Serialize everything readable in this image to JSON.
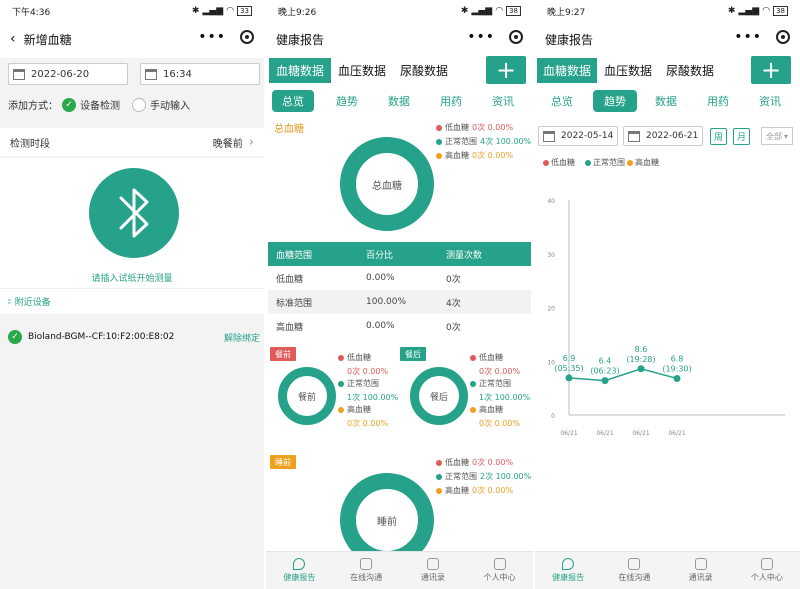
{
  "p1": {
    "status_time": "下午4:36",
    "battery": "33",
    "nav_title": "新增血糖",
    "date": "2022-06-20",
    "time": "16:34",
    "add_method_label": "添加方式：",
    "method_device": "设备检测",
    "method_manual": "手动输入",
    "period_label": "检测时段",
    "period_value": "晚餐前",
    "bt_hint": "请插入试纸开始测量",
    "nearby_label": "附近设备",
    "device_name": "Bioland-BGM--CF:10:F2:00:E8:02",
    "unbind": "解除绑定"
  },
  "p2": {
    "status_time": "晚上9:26",
    "battery": "38",
    "nav_title": "健康报告",
    "type_tabs": [
      "血糖数据",
      "血压数据",
      "尿酸数据"
    ],
    "sub_tabs": [
      "总览",
      "趋势",
      "数据",
      "用药",
      "资讯"
    ],
    "section_total": "总血糖",
    "donut_total": "总血糖",
    "legend_total": [
      {
        "name": "低血糖",
        "value": "0次 0.00%",
        "color": "#e05a5a"
      },
      {
        "name": "正常范围",
        "value": "4次 100.00%",
        "color": "#26a28a"
      },
      {
        "name": "高血糖",
        "value": "0次 0.00%",
        "color": "#f0a020"
      }
    ],
    "table": {
      "headers": [
        "血糖范围",
        "百分比",
        "测量次数"
      ],
      "rows": [
        [
          "低血糖",
          "0.00%",
          "0次"
        ],
        [
          "标准范围",
          "100.00%",
          "4次"
        ],
        [
          "高血糖",
          "0.00%",
          "0次"
        ]
      ]
    },
    "tag_before_meal": "餐前",
    "tag_after_meal": "餐后",
    "donut_before": "餐前",
    "donut_after": "餐后",
    "legend_before": [
      {
        "name": "低血糖",
        "value": "0次 0.00%",
        "color": "#e05a5a"
      },
      {
        "name": "正常范围",
        "value": "1次 100.00%",
        "color": "#26a28a"
      },
      {
        "name": "高血糖",
        "value": "0次 0.00%",
        "color": "#f0a020"
      }
    ],
    "legend_after": [
      {
        "name": "低血糖",
        "value": "0次 0.00%",
        "color": "#e05a5a"
      },
      {
        "name": "正常范围",
        "value": "1次 100.00%",
        "color": "#26a28a"
      },
      {
        "name": "高血糖",
        "value": "0次 0.00%",
        "color": "#f0a020"
      }
    ],
    "tag_sleep": "睡前",
    "donut_sleep": "睡前",
    "legend_sleep": [
      {
        "name": "低血糖",
        "value": "0次 0.00%",
        "color": "#e05a5a"
      },
      {
        "name": "正常范围",
        "value": "2次 100.00%",
        "color": "#26a28a"
      },
      {
        "name": "高血糖",
        "value": "0次 0.00%",
        "color": "#f0a020"
      }
    ],
    "tabbar": [
      "健康报告",
      "在线沟通",
      "通讯录",
      "个人中心"
    ]
  },
  "p3": {
    "status_time": "晚上9:27",
    "battery": "38",
    "nav_title": "健康报告",
    "type_tabs": [
      "血糖数据",
      "血压数据",
      "尿酸数据"
    ],
    "sub_tabs": [
      "总览",
      "趋势",
      "数据",
      "用药",
      "资讯"
    ],
    "start_date": "2022-05-14",
    "end_date": "2022-06-21",
    "btn_week": "周",
    "btn_month": "月",
    "select_all": "全部",
    "legend": [
      {
        "name": "低血糖",
        "color": "#e05a5a"
      },
      {
        "name": "正常范围",
        "color": "#26a28a"
      },
      {
        "name": "高血糖",
        "color": "#f0a020"
      }
    ],
    "tabbar": [
      "健康报告",
      "在线沟通",
      "通讯录",
      "个人中心"
    ]
  },
  "chart_data": {
    "type": "line",
    "y_ticks": [
      "40",
      "30",
      "20",
      "10",
      "0"
    ],
    "ylim": [
      0,
      40
    ],
    "x_ticks": [
      "06/21",
      "06/21",
      "06/21",
      "06/21"
    ],
    "points": [
      {
        "value": 6.9,
        "label": "6.9",
        "time": "(05:35)"
      },
      {
        "value": 6.4,
        "label": "6.4",
        "time": "(06:23)"
      },
      {
        "value": 8.6,
        "label": "8.6",
        "time": "(19:28)"
      },
      {
        "value": 6.8,
        "label": "6.8",
        "time": "(19:30)"
      }
    ],
    "series": [
      {
        "values": [
          6.9,
          6.4,
          8.6,
          6.8
        ],
        "color": "#26a28a"
      }
    ]
  }
}
